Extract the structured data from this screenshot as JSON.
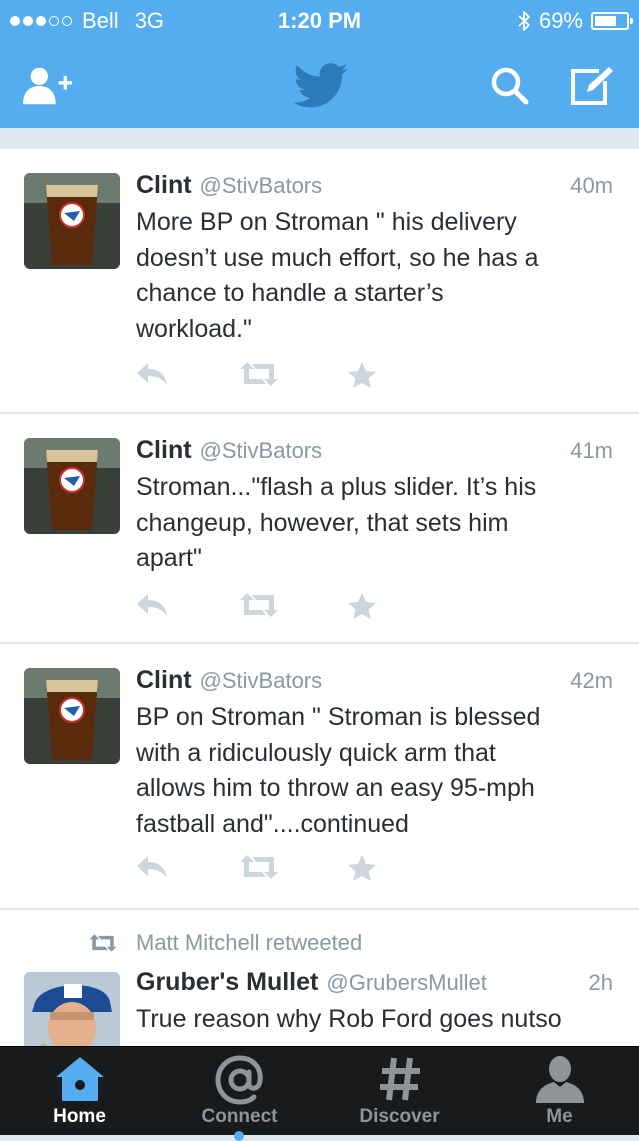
{
  "status_bar": {
    "carrier": "Bell",
    "network": "3G",
    "time": "1:20 PM",
    "battery": "69%",
    "battery_level": 0.69,
    "signal_bars": 3
  },
  "nav": {
    "add_user_icon": "add-user-icon",
    "logo_icon": "twitter-bird-icon",
    "search_icon": "search-icon",
    "compose_icon": "compose-icon"
  },
  "tweets": [
    {
      "name": "Clint",
      "handle": "@StivBators",
      "time": "40m",
      "lines": [
        "More BP on Stroman \" his delivery",
        "doesn’t use much effort, so he has a",
        "chance to handle a starter’s",
        "workload.\""
      ]
    },
    {
      "name": "Clint",
      "handle": "@StivBators",
      "time": "41m",
      "lines": [
        "Stroman...\"flash a plus slider. It’s his",
        "changeup, however,  that sets him",
        "apart\""
      ]
    },
    {
      "name": "Clint",
      "handle": "@StivBators",
      "time": "42m",
      "lines": [
        "BP on Stroman \" Stroman is blessed",
        "with a ridiculously quick arm that",
        "allows him to throw an easy 95-mph",
        "fastball and\"....continued"
      ]
    },
    {
      "retweeted_by": "Matt Mitchell retweeted",
      "name": "Gruber's Mullet",
      "handle": "@GrubersMullet",
      "time": "2h",
      "lines": [
        "True reason why Rob Ford goes nutso"
      ]
    }
  ],
  "tabs": [
    {
      "label": "Home",
      "icon": "home-icon",
      "active": true
    },
    {
      "label": "Connect",
      "icon": "at-icon",
      "active": false
    },
    {
      "label": "Discover",
      "icon": "hashtag-icon",
      "active": false
    },
    {
      "label": "Me",
      "icon": "person-icon",
      "active": false
    }
  ],
  "colors": {
    "accent": "#55acee",
    "tab_bar": "#181a1c",
    "text": "#292f33",
    "muted": "#8899a6",
    "action_icon": "#ccd6dd"
  }
}
